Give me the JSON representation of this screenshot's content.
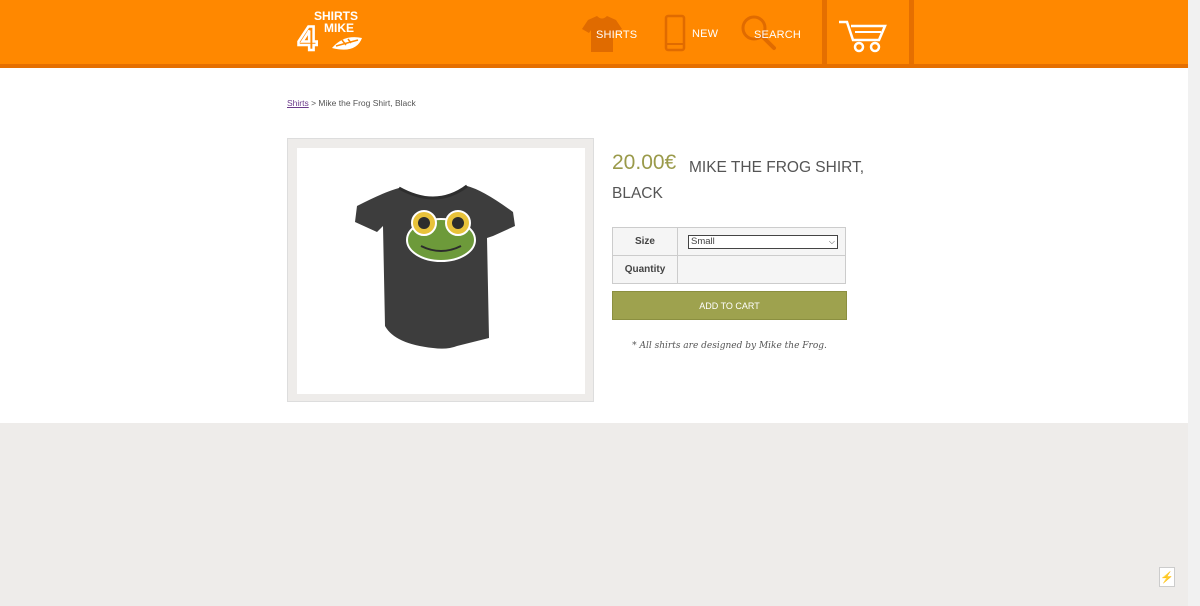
{
  "brand": {
    "logo_top": "SHIRTS",
    "logo_bottom": "MIKE",
    "logo_number": "4"
  },
  "nav": {
    "shirts": "SHIRTS",
    "new": "NEW",
    "search": "SEARCH"
  },
  "breadcrumb": {
    "link": "Shirts",
    "separator": " > ",
    "current": "Mike the Frog Shirt, Black"
  },
  "product": {
    "price": "20.00€",
    "name": "MIKE THE FROG SHIRT, BLACK",
    "size_label": "Size",
    "size_value": "Small",
    "quantity_label": "Quantity",
    "add_to_cart": "ADD TO CART",
    "note": "* All shirts are designed by Mike the Frog."
  },
  "colors": {
    "header": "#ff8800",
    "header_dark": "#e56f00",
    "accent": "#9ea24e"
  }
}
